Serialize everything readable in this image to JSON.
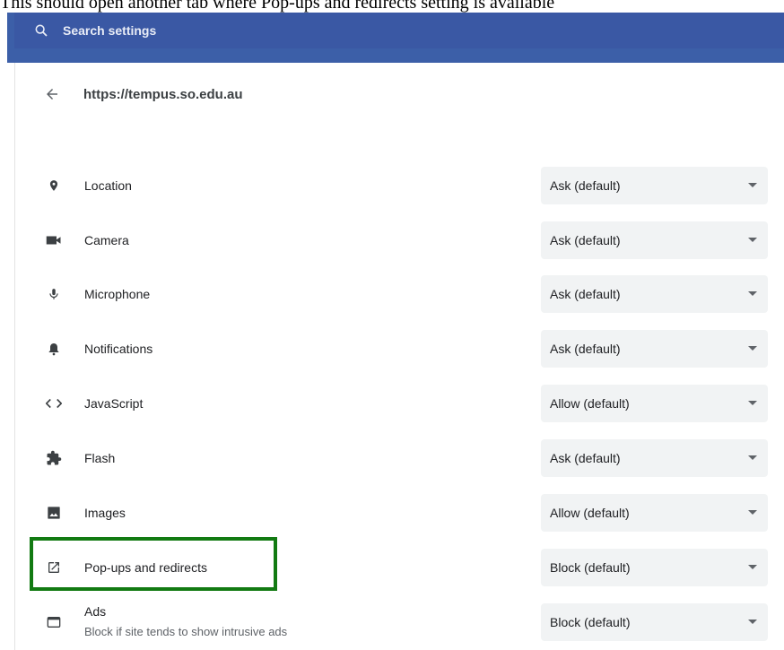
{
  "caption": "This should open another tab where Pop-ups and redirects setting is available",
  "search": {
    "placeholder": "Search settings",
    "icon": "search-icon"
  },
  "site": {
    "url": "https://tempus.so.edu.au",
    "back_icon": "back-arrow-icon"
  },
  "permissions": [
    {
      "label": "Location",
      "icon": "location-pin-icon",
      "value": "Ask (default)"
    },
    {
      "label": "Camera",
      "icon": "camera-icon",
      "value": "Ask (default)"
    },
    {
      "label": "Microphone",
      "icon": "microphone-icon",
      "value": "Ask (default)"
    },
    {
      "label": "Notifications",
      "icon": "bell-icon",
      "value": "Ask (default)"
    },
    {
      "label": "JavaScript",
      "icon": "code-icon",
      "value": "Allow (default)"
    },
    {
      "label": "Flash",
      "icon": "puzzle-piece-icon",
      "value": "Ask (default)"
    },
    {
      "label": "Images",
      "icon": "image-icon",
      "value": "Allow (default)"
    },
    {
      "label": "Pop-ups and redirects",
      "icon": "open-in-new-icon",
      "value": "Block (default)"
    },
    {
      "label": "Ads",
      "sublabel": "Block if site tends to show intrusive ads",
      "icon": "ads-window-icon",
      "value": "Block (default)"
    }
  ],
  "colors": {
    "header": "#3c5fa8",
    "highlight_box": "#127a12",
    "select_bg": "#f1f3f4"
  }
}
